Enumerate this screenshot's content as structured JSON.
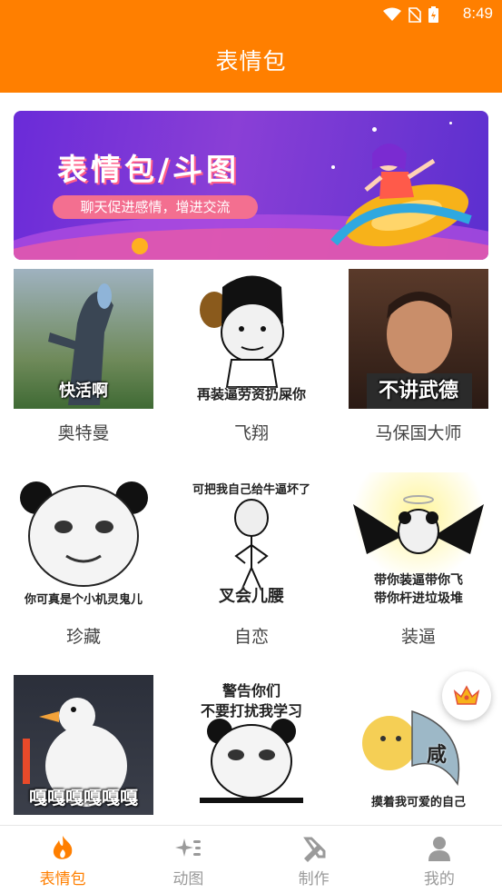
{
  "status_bar": {
    "time": "8:49"
  },
  "header": {
    "title": "表情包"
  },
  "banner": {
    "title": "表情包/斗图",
    "subtitle": "聊天促进感情，增进交流"
  },
  "grid": [
    {
      "label": "奥特曼",
      "caption": "快活啊"
    },
    {
      "label": "飞翔",
      "caption": "再装逼劳资扔屎你"
    },
    {
      "label": "马保国大师",
      "caption": "不讲武德"
    },
    {
      "label": "珍藏",
      "caption": "你可真是个小机灵鬼儿"
    },
    {
      "label": "自恋",
      "caption_top": "可把我自己给牛逼坏了",
      "caption": "叉会儿腰"
    },
    {
      "label": "装逼",
      "caption": "带你装逼带你飞",
      "caption2": "带你杆进垃圾堆"
    },
    {
      "label": "",
      "caption": "嘎嘎嘎嘎嘎嘎"
    },
    {
      "label": "",
      "caption_top": "警告你们",
      "caption_top2": "不要打扰我学习"
    },
    {
      "label": "",
      "caption": "摸着我可爱的自己",
      "caption_mid": "咸"
    }
  ],
  "bottom_nav": [
    {
      "label": "表情包",
      "icon": "flame-icon",
      "active": true
    },
    {
      "label": "动图",
      "icon": "sparkle-icon",
      "active": false
    },
    {
      "label": "制作",
      "icon": "tools-icon",
      "active": false
    },
    {
      "label": "我的",
      "icon": "person-icon",
      "active": false
    }
  ],
  "colors": {
    "primary": "#ff7f00",
    "inactive": "#9a9a9a"
  }
}
